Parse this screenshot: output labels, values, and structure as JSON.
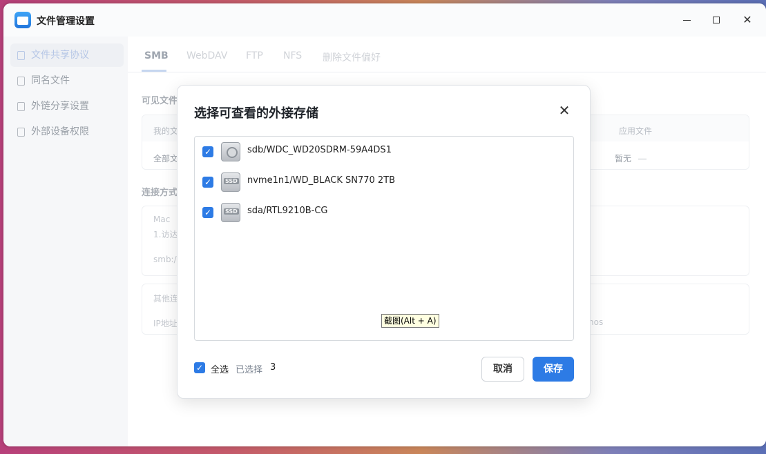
{
  "window": {
    "title": "文件管理设置",
    "controls": {
      "minimize": "minimize-icon",
      "maximize": "maximize-icon",
      "close": "✕"
    }
  },
  "sidebar": {
    "items": [
      {
        "label": "文件共享协议",
        "icon": "document-icon",
        "active": true
      },
      {
        "label": "同名文件",
        "icon": "file-icon",
        "active": false
      },
      {
        "label": "外链分享设置",
        "icon": "share-icon",
        "active": false
      },
      {
        "label": "外部设备权限",
        "icon": "drive-icon",
        "active": false
      }
    ]
  },
  "tabs": [
    {
      "label": "SMB",
      "active": true
    },
    {
      "label": "WebDAV",
      "active": false
    },
    {
      "label": "FTP",
      "active": false
    },
    {
      "label": "NFS",
      "active": false
    },
    {
      "label": "删除文件偏好",
      "active": false
    }
  ],
  "background": {
    "visible_files_label": "可见文件",
    "table_head_left": "我的文",
    "table_head_right": "应用文件",
    "table_cell_left": "全部文",
    "table_cell_right": "暂无",
    "connection_label": "连接方式",
    "mac_label": "Mac",
    "mac_step": "1.访达",
    "smb_prefix": "smb:/",
    "other_label": "其他连",
    "ip_label": "IP地址",
    "nos_suffix": "nos"
  },
  "dialog": {
    "title": "选择可查看的外接存储",
    "close": "✕",
    "devices": [
      {
        "name": "sdb/WDC_WD20SDRM-59A4DS1",
        "type": "hdd",
        "checked": true
      },
      {
        "name": "nvme1n1/WD_BLACK SN770 2TB",
        "type": "ssd",
        "checked": true
      },
      {
        "name": "sda/RTL9210B-CG",
        "type": "ssd",
        "checked": true
      }
    ],
    "ssd_badge": "SSD",
    "tooltip": "截图(Alt + A)",
    "select_all_label": "全选",
    "selected_label": "已选择",
    "selected_count": "3",
    "cancel_label": "取消",
    "save_label": "保存",
    "check_mark": "✓"
  },
  "colors": {
    "accent": "#2d7be5"
  }
}
